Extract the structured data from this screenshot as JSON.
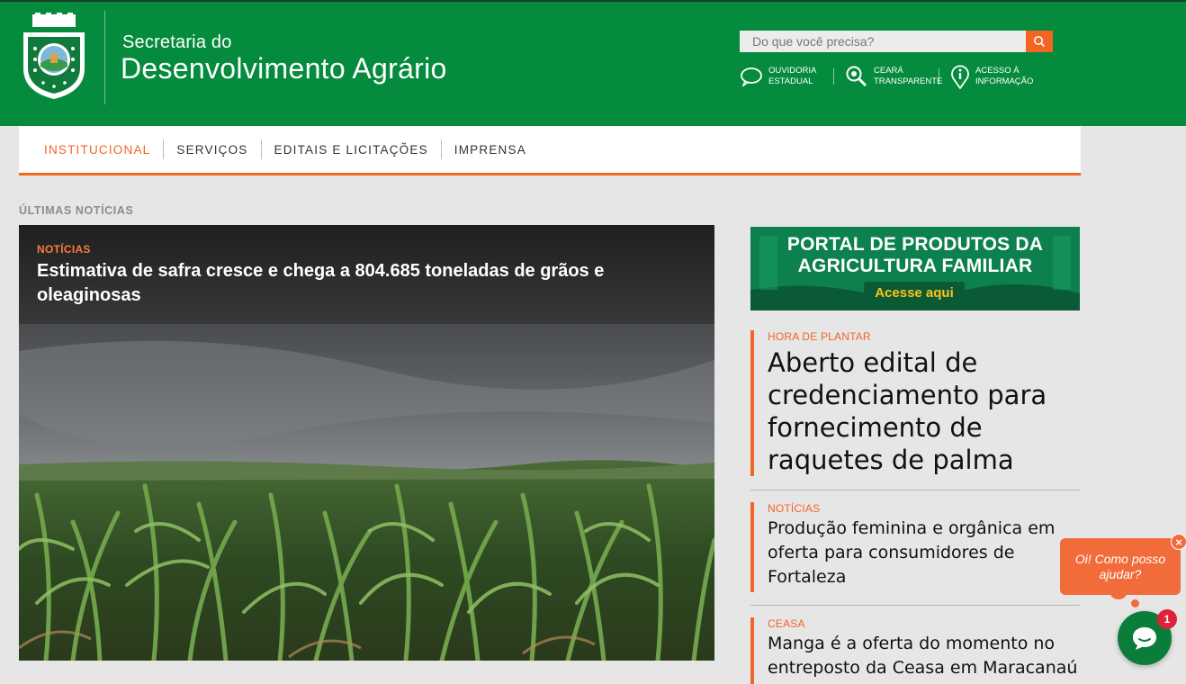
{
  "header": {
    "brand_line1": "Secretaria do",
    "brand_line2": "Desenvolvimento Agrário",
    "search_placeholder": "Do que você precisa?",
    "links": [
      {
        "icon": "speech-bubble-icon",
        "line1": "OUVIDORIA",
        "line2": "ESTADUAL"
      },
      {
        "icon": "magnifier-icon",
        "line1": "CEARÁ",
        "line2": "TRANSPARENTE"
      },
      {
        "icon": "info-icon",
        "line1": "ACESSO À",
        "line2": "INFORMAÇÃO"
      }
    ]
  },
  "nav": {
    "items": [
      {
        "label": "INSTITUCIONAL",
        "active": true
      },
      {
        "label": "SERVIÇOS",
        "active": false
      },
      {
        "label": "EDITAIS E LICITAÇÕES",
        "active": false
      },
      {
        "label": "IMPRENSA",
        "active": false
      }
    ]
  },
  "section_label": "ÚLTIMAS NOTÍCIAS",
  "hero": {
    "category": "NOTÍCIAS",
    "title": "Estimativa de safra cresce e chega a 804.685 toneladas de grãos e oleaginosas"
  },
  "banner": {
    "line1": "PORTAL DE PRODUTOS DA",
    "line2": "AGRICULTURA FAMILIAR",
    "cta": "Acesse aqui"
  },
  "news": [
    {
      "category": "HORA DE PLANTAR",
      "title": "Aberto edital de credenciamento para fornecimento de raquetes de palma"
    },
    {
      "category": "NOTÍCIAS",
      "title": "Produção feminina e orgânica em oferta para consumidores de Fortaleza"
    },
    {
      "category": "CEASA",
      "title": "Manga é a oferta do momento no entreposto da Ceasa em Maracanaú"
    }
  ],
  "chat": {
    "greeting": "Oi! Como posso ajudar?",
    "badge": "1",
    "close": "×"
  },
  "colors": {
    "header_green": "#058b3e",
    "accent_orange": "#f26522",
    "background": "#e6e6e6"
  }
}
